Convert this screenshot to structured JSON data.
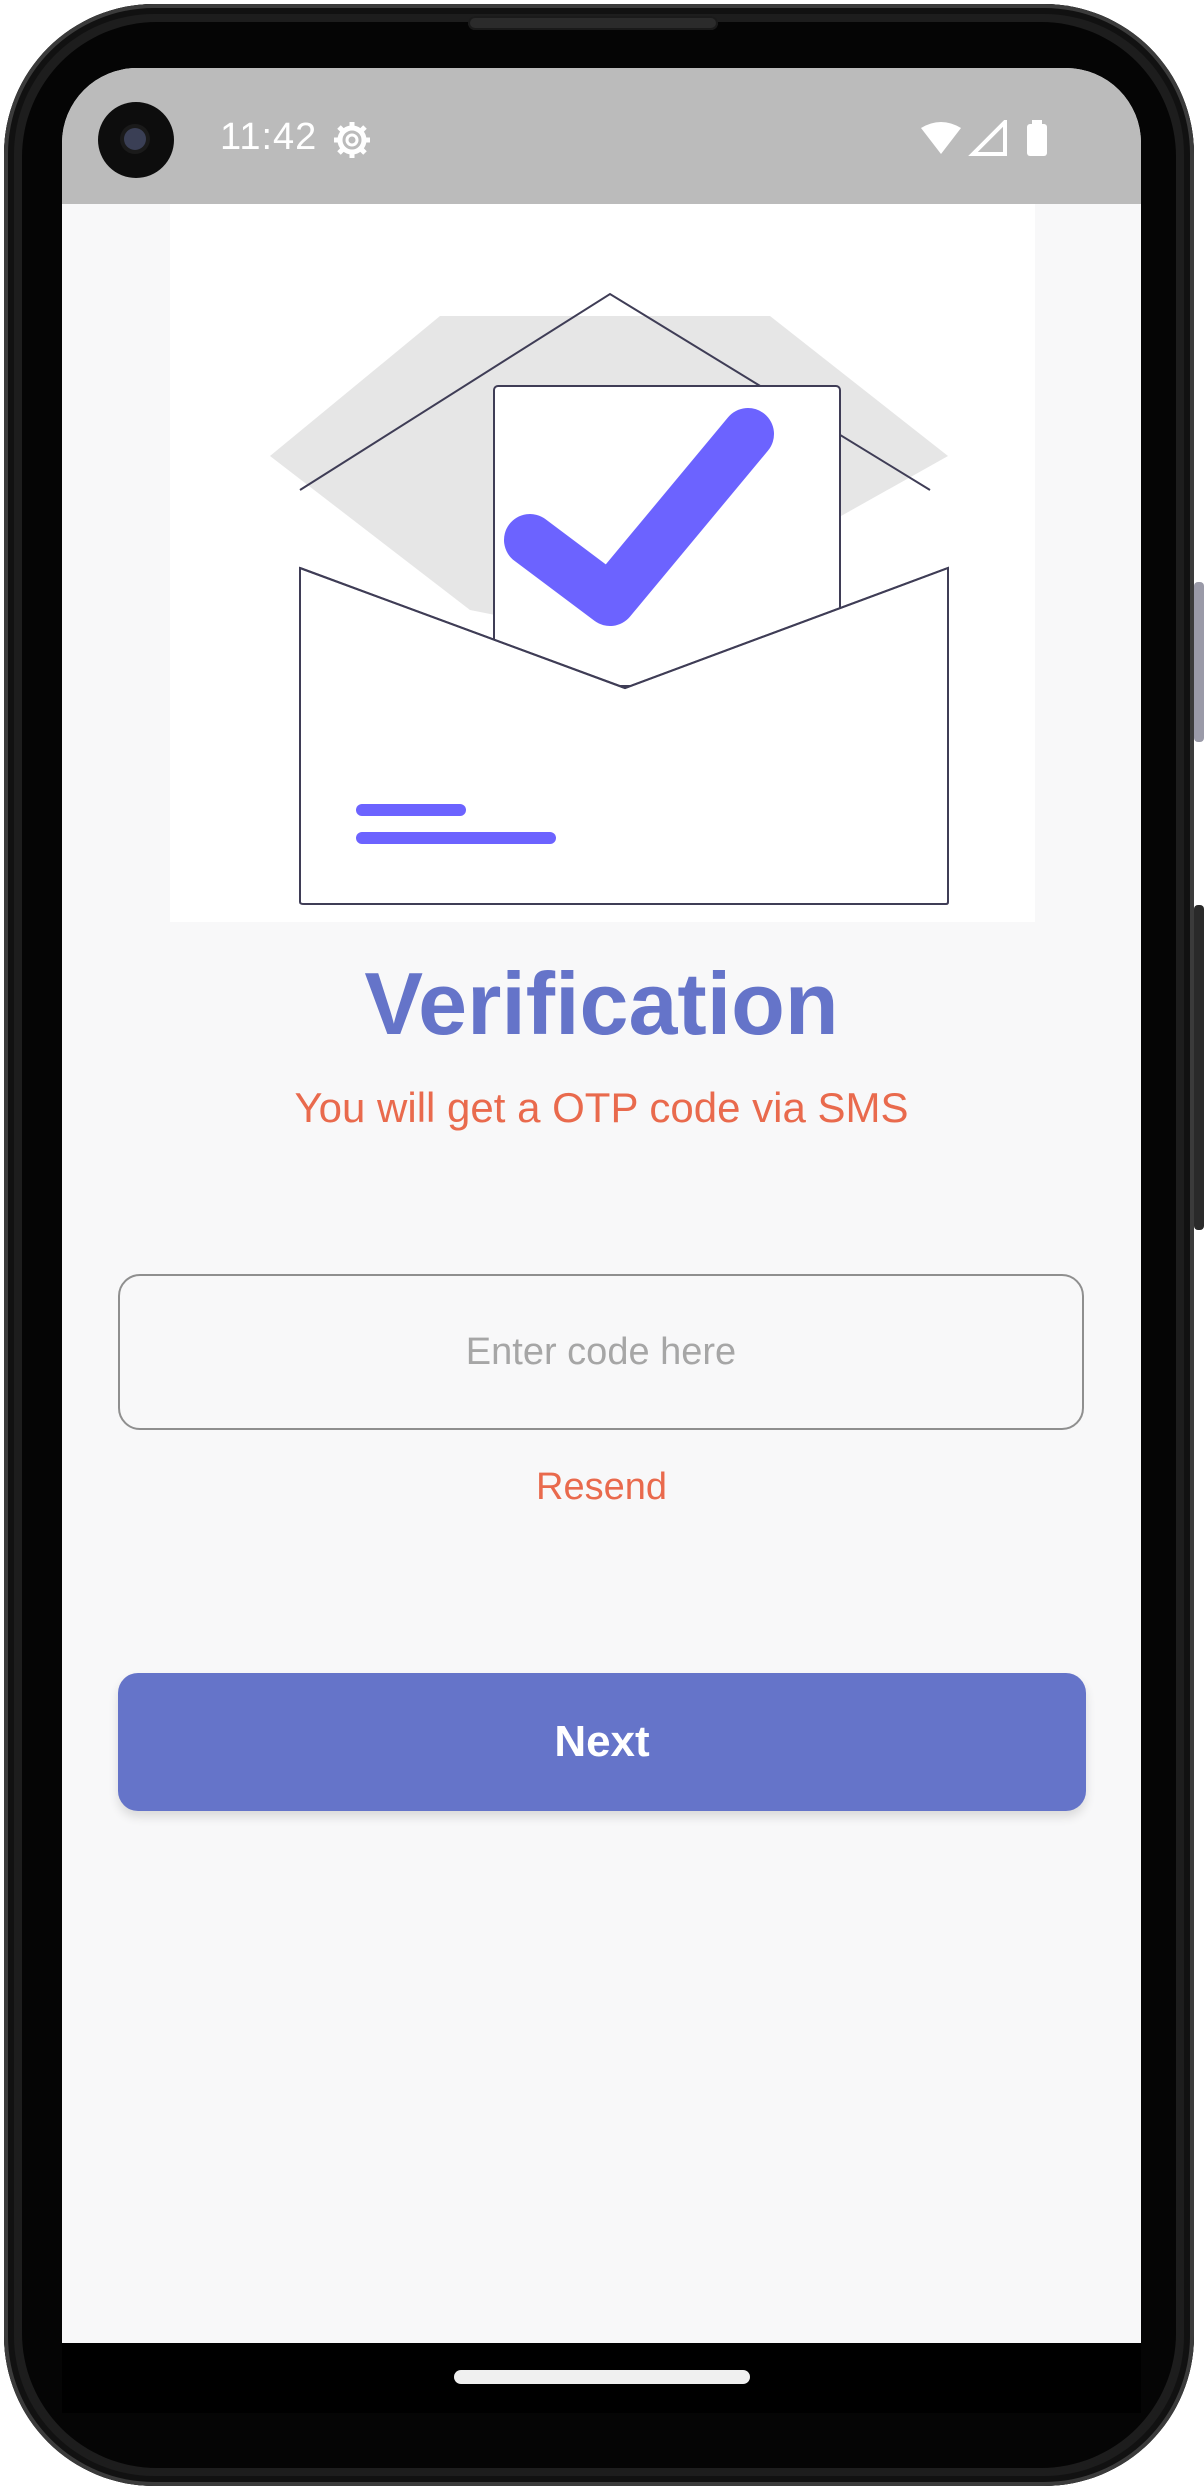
{
  "status_bar": {
    "time": "11:42",
    "icons": [
      "settings-gear-icon",
      "wifi-icon",
      "cellular-signal-icon",
      "battery-icon"
    ]
  },
  "illustration": {
    "name": "envelope-with-checkmark",
    "accent_color": "#6c63ff",
    "outline_color": "#3f3d56"
  },
  "verification": {
    "title": "Verification",
    "subtitle": "You will get a OTP code via SMS",
    "code_placeholder": "Enter code here",
    "code_value": "",
    "resend_label": "Resend",
    "next_label": "Next"
  },
  "colors": {
    "primary": "#6574c9",
    "accent": "#e96a4d",
    "background": "#f8f8f9",
    "status_bar": "#bbbbbb"
  }
}
